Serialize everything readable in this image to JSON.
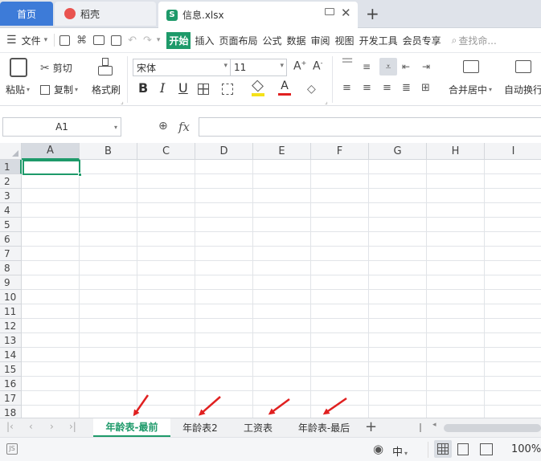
{
  "tabs": {
    "home": "首页",
    "docer": "稻壳",
    "file": "信息.xlsx",
    "new_tab": "+"
  },
  "toolbar": {
    "file_menu": "文件",
    "menus": [
      "开始",
      "插入",
      "页面布局",
      "公式",
      "数据",
      "审阅",
      "视图",
      "开发工具",
      "会员专享"
    ],
    "search_placeholder": "查找命..."
  },
  "ribbon": {
    "paste": "粘贴",
    "cut": "剪切",
    "copy": "复制",
    "format_painter": "格式刷",
    "font_name": "宋体",
    "font_size": "11",
    "bold": "B",
    "italic": "I",
    "underline": "U",
    "merge_center": "合并居中",
    "auto_wrap": "自动换行"
  },
  "formula_bar": {
    "name_box": "A1",
    "fx": "fx",
    "value": ""
  },
  "grid": {
    "columns": [
      "A",
      "B",
      "C",
      "D",
      "E",
      "F",
      "G",
      "H",
      "I"
    ],
    "rows": [
      "1",
      "2",
      "3",
      "4",
      "5",
      "6",
      "7",
      "8",
      "9",
      "10",
      "11",
      "12",
      "13",
      "14",
      "15",
      "16",
      "17",
      "18"
    ],
    "selected_cell": "A1"
  },
  "sheets": [
    {
      "label": "年龄表-最前",
      "active": true
    },
    {
      "label": "年龄表2",
      "active": false
    },
    {
      "label": "工资表",
      "active": false
    },
    {
      "label": "年龄表-最后",
      "active": false
    }
  ],
  "sheet_add": "+",
  "status": {
    "zoom": "100%",
    "ime": "中"
  },
  "colors": {
    "accent_green": "#1e9a6a",
    "home_tab_blue": "#3d7bd8",
    "annotation_red": "#e02020"
  }
}
